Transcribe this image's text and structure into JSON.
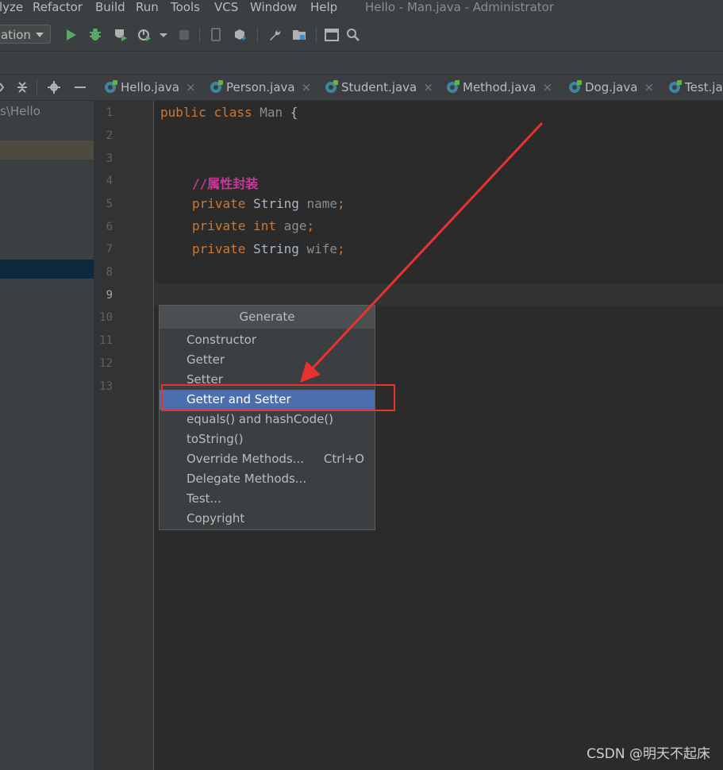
{
  "window": {
    "title": "Hello - Man.java - Administrator"
  },
  "menubar": {
    "items": [
      "lyze",
      "Refactor",
      "Build",
      "Run",
      "Tools",
      "VCS",
      "Window",
      "Help"
    ]
  },
  "toolbar": {
    "run_config": "ation",
    "icons": [
      "run-icon",
      "debug-icon",
      "coverage-icon",
      "profile-icon",
      "stop-icon",
      "device-icon",
      "build-icon",
      "settings-icon",
      "project-structure-icon",
      "terminal-icon",
      "search-icon"
    ]
  },
  "project_panel": {
    "path": "s\\Hello"
  },
  "tabs": [
    {
      "label": "Hello.java",
      "close": "×"
    },
    {
      "label": "Person.java",
      "close": "×"
    },
    {
      "label": "Student.java",
      "close": "×"
    },
    {
      "label": "Method.java",
      "close": "×"
    },
    {
      "label": "Dog.java",
      "close": "×"
    },
    {
      "label": "Test.ja",
      "close": ""
    }
  ],
  "gutter": {
    "line_numbers": [
      "1",
      "2",
      "3",
      "4",
      "5",
      "6",
      "7",
      "8",
      "9",
      "10",
      "11",
      "12",
      "13"
    ],
    "current_line": "9"
  },
  "code": {
    "line1": {
      "kw1": "public",
      "kw2": "class",
      "name": "Man",
      "brace": "{"
    },
    "line4": {
      "comment": "//属性封装"
    },
    "line5": {
      "kw": "private",
      "type": "String",
      "ident": "name",
      "semi": ";"
    },
    "line6": {
      "kw": "private",
      "type": "int",
      "ident": "age",
      "semi": ";"
    },
    "line7": {
      "kw": "private",
      "type": "String",
      "ident": "wife",
      "semi": ";"
    }
  },
  "popup": {
    "title": "Generate",
    "items": [
      {
        "label": "Constructor",
        "shortcut": ""
      },
      {
        "label": "Getter",
        "shortcut": ""
      },
      {
        "label": "Setter",
        "shortcut": ""
      },
      {
        "label": "Getter and Setter",
        "shortcut": "",
        "selected": true
      },
      {
        "label": "equals() and hashCode()",
        "shortcut": ""
      },
      {
        "label": "toString()",
        "shortcut": ""
      },
      {
        "label": "Override Methods...",
        "shortcut": "Ctrl+O"
      },
      {
        "label": "Delegate Methods...",
        "shortcut": ""
      },
      {
        "label": "Test...",
        "shortcut": ""
      },
      {
        "label": "Copyright",
        "shortcut": ""
      }
    ]
  },
  "colors": {
    "accent_selection": "#4b6eaf",
    "annotation_red": "#e8322e",
    "keyword": "#cc7832",
    "comment": "#c23b94"
  },
  "watermark": "CSDN @明天不起床"
}
